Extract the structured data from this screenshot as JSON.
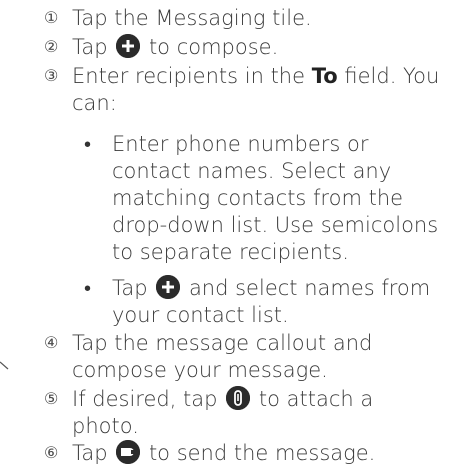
{
  "steps": [
    {
      "num": "①",
      "text": "Tap the Messaging tile."
    },
    {
      "num": "②",
      "text_a": "Tap",
      "text_b": "to compose."
    },
    {
      "num": "③",
      "text_a": "Enter recipients in the",
      "bold": "To",
      "text_b": "field. You",
      "text_c": "can:"
    },
    {
      "num": "④",
      "text_a": "Tap the message callout and",
      "text_b": "compose your message."
    },
    {
      "num": "⑤",
      "text_a": "If desired, tap",
      "text_b": "to attach a",
      "text_c": "photo."
    },
    {
      "num": "⑥",
      "text_a": "Tap",
      "text_b": "to send the message."
    }
  ],
  "bullets": [
    {
      "lines": [
        "Enter phone numbers or",
        "contact names. Select any",
        "matching contacts from the",
        "drop-down list. Use semicolons",
        "to separate recipients."
      ]
    },
    {
      "text_a": "Tap",
      "text_b": "and select names from",
      "line2": "your contact list."
    }
  ],
  "bullet_symbol": "•",
  "icons": {
    "compose": "plus-circle-icon",
    "attach": "paperclip-icon",
    "send": "send-icon"
  }
}
